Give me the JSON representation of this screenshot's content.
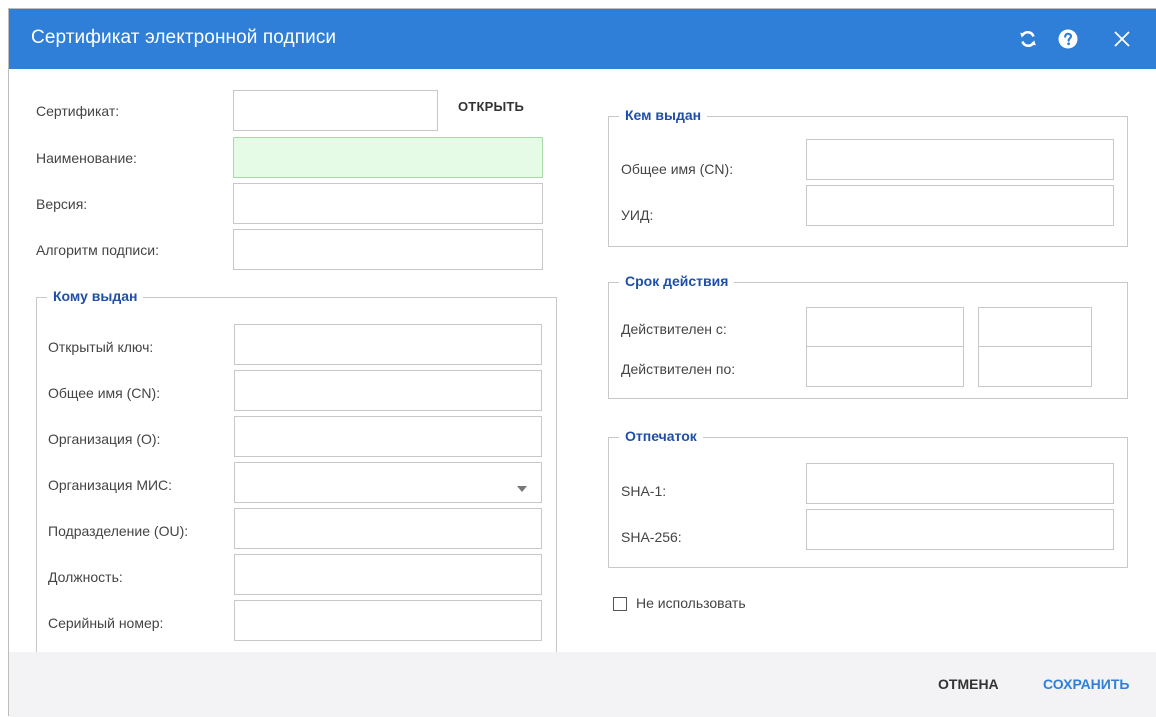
{
  "window": {
    "title": "Сертификат электронной подписи"
  },
  "main": {
    "certificate_label": "Сертификат:",
    "open_button": "ОТКРЫТЬ",
    "name_label": "Наименование:",
    "version_label": "Версия:",
    "algorithm_label": "Алгоритм подписи:"
  },
  "issued_to": {
    "legend": "Кому выдан",
    "public_key_label": "Открытый ключ:",
    "common_name_label": "Общее имя (CN):",
    "organization_label": "Организация (O):",
    "mis_org_label": "Организация МИС:",
    "department_label": "Подразделение (OU):",
    "position_label": "Должность:",
    "serial_label": "Серийный номер:"
  },
  "issued_by": {
    "legend": "Кем выдан",
    "common_name_label": "Общее имя (CN):",
    "uid_label": "УИД:"
  },
  "validity": {
    "legend": "Срок действия",
    "valid_from_label": "Действителен с:",
    "valid_to_label": "Действителен по:"
  },
  "fingerprint": {
    "legend": "Отпечаток",
    "sha1_label": "SHA-1:",
    "sha256_label": "SHA-256:"
  },
  "options": {
    "do_not_use_label": "Не использовать",
    "do_not_use_checked": false
  },
  "footer": {
    "cancel_label": "ОТМЕНА",
    "save_label": "СОХРАНИТЬ"
  },
  "icons": {
    "refresh": "refresh-icon",
    "help": "help-icon",
    "close": "close-icon",
    "dropdown": "chevron-down-icon"
  },
  "colors": {
    "titlebar": "#2f7fd8",
    "legend": "#1f4fa8",
    "save_button": "#2f7fd8",
    "required_field": "#e6fbe6"
  }
}
